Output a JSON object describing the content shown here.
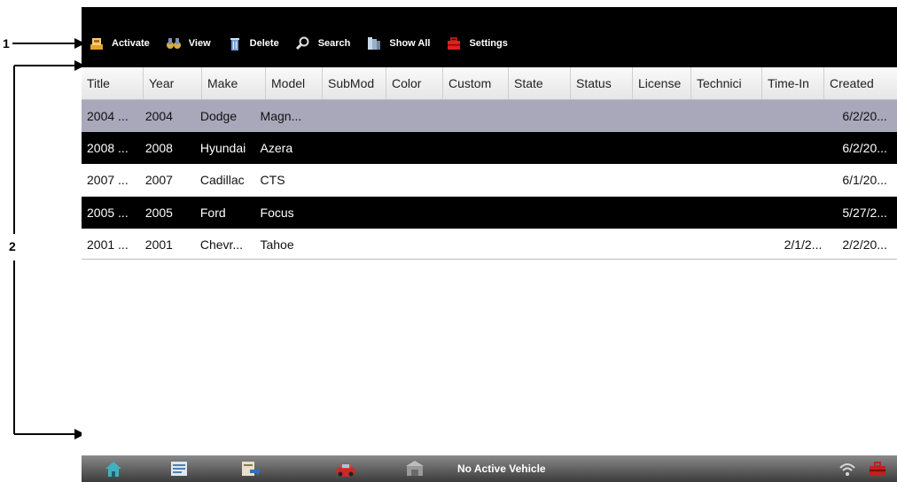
{
  "callouts": {
    "one": "1",
    "two": "2"
  },
  "toolbar": {
    "activate": "Activate",
    "view": "View",
    "delete": "Delete",
    "search": "Search",
    "show_all": "Show All",
    "settings": "Settings"
  },
  "table": {
    "headers": [
      "Title",
      "Year",
      "Make",
      "Model",
      "SubMod",
      "Color",
      "Custom",
      "State",
      "Status",
      "License",
      "Technici",
      "Time-In",
      "Created"
    ],
    "rows": [
      {
        "style": "selected",
        "cells": [
          "2004 ...",
          "2004",
          "Dodge",
          "Magn...",
          "",
          "",
          "",
          "",
          "",
          "",
          "",
          "",
          "6/2/20..."
        ]
      },
      {
        "style": "dark",
        "cells": [
          "2008 ...",
          "2008",
          "Hyundai",
          "Azera",
          "",
          "",
          "",
          "",
          "",
          "",
          "",
          "",
          "6/2/20..."
        ]
      },
      {
        "style": "light",
        "cells": [
          "2007 ...",
          "2007",
          "Cadillac",
          "CTS",
          "",
          "",
          "",
          "",
          "",
          "",
          "",
          "",
          "6/1/20..."
        ]
      },
      {
        "style": "dark",
        "cells": [
          "2005 ...",
          "2005",
          "Ford",
          "Focus",
          "",
          "",
          "",
          "",
          "",
          "",
          "",
          "",
          "5/27/2..."
        ]
      },
      {
        "style": "light",
        "cells": [
          "2001 ...",
          "2001",
          "Chevr...",
          "Tahoe",
          "",
          "",
          "",
          "",
          "",
          "",
          "",
          "2/1/2...",
          "2/2/20..."
        ]
      }
    ]
  },
  "bottombar": {
    "status": "No Active Vehicle",
    "icons": [
      "home-icon",
      "data-manager-icon",
      "export-icon",
      "vehicle-icon",
      "shop-icon",
      "wifi-icon",
      "toolbox-icon"
    ]
  }
}
